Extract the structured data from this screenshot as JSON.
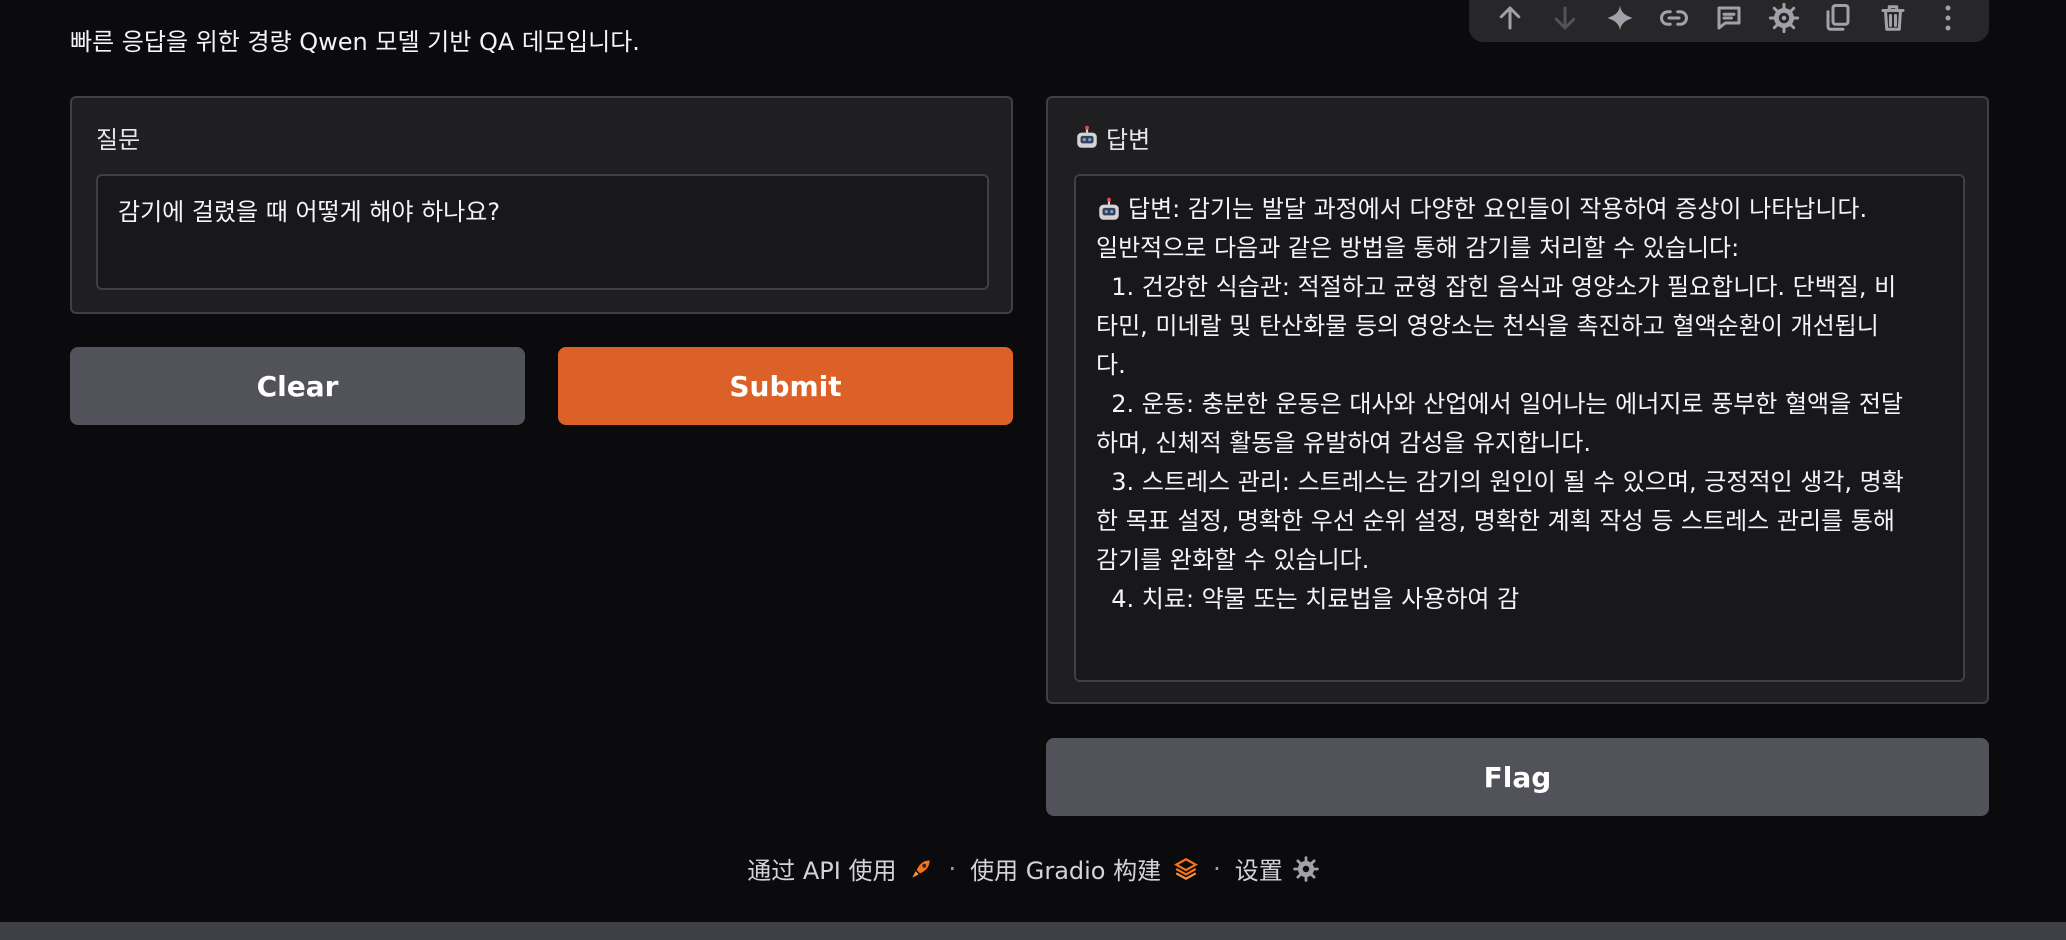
{
  "header": {
    "subtitle": "빠른 응답을 위한 경량 Qwen 모델 기반 QA 데모입니다."
  },
  "toolbar": {
    "icons": [
      "arrow-up-icon",
      "arrow-down-icon",
      "sparkle-icon",
      "link-icon",
      "comment-icon",
      "gear-icon",
      "copy-icon",
      "trash-icon",
      "more-icon"
    ]
  },
  "question": {
    "label": "질문",
    "value": "감기에 걸렸을 때 어떻게 해야 하나요?"
  },
  "buttons": {
    "clear": "Clear",
    "submit": "Submit",
    "flag": "Flag"
  },
  "answer": {
    "label": "답변",
    "lines": [
      "답변: 감기는 발달 과정에서 다양한 요인들이 작용하여 증상이 나타납니다.",
      "일반적으로 다음과 같은 방법을 통해 감기를 처리할 수 있습니다:",
      "",
      "  1. 건강한 식습관: 적절하고 균형 잡힌 음식과 영양소가 필요합니다. 단백질, 비",
      "타민, 미네랄 및 탄산화물 등의 영양소는 천식을 촉진하고 혈액순환이 개선됩니",
      "다.",
      "  2. 운동: 충분한 운동은 대사와 산업에서 일어나는 에너지로 풍부한 혈액을 전달",
      "하며, 신체적 활동을 유발하여 감성을 유지합니다.",
      "  3. 스트레스 관리: 스트레스는 감기의 원인이 될 수 있으며, 긍정적인 생각, 명확",
      "한 목표 설정, 명확한 우선 순위 설정, 명확한 계획 작성 등 스트레스 관리를 통해",
      "감기를 완화할 수 있습니다.",
      "  4. 치료: 약물 또는 치료법을 사용하여 감"
    ]
  },
  "footer": {
    "api": "通过 API 使用",
    "sep1": "·",
    "built": "使用 Gradio 构建",
    "sep2": "·",
    "settings": "设置"
  },
  "colors": {
    "background": "#0b0b0d",
    "panel": "#1f1f22",
    "submit": "#dc6128",
    "secondary_button": "#52525b"
  }
}
